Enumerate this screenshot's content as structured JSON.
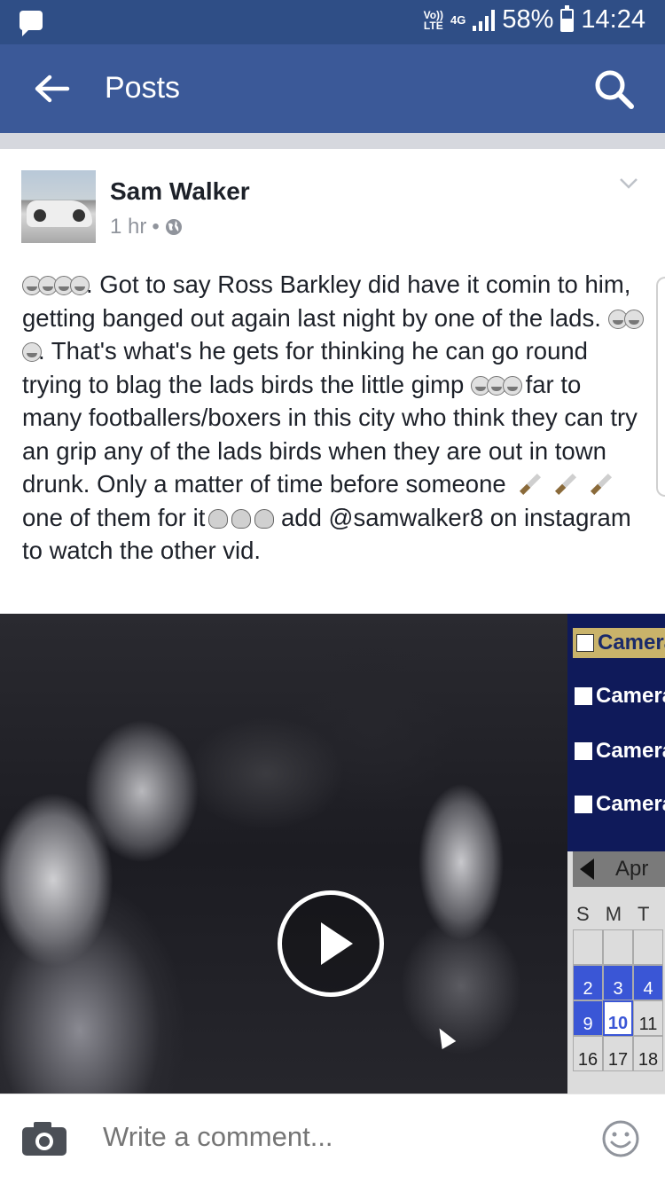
{
  "status_bar": {
    "volte": "Vo)) LTE",
    "network": "4G",
    "battery": "58%",
    "time": "14:24"
  },
  "app_bar": {
    "title": "Posts"
  },
  "post": {
    "author": "Sam Walker",
    "time": "1 hr",
    "dot": "•",
    "text": {
      "p1": ". Got to say Ross Barkley did have it comin to him, getting banged out again last night by one of the lads. ",
      "p2": ". That's what's he gets for thinking he can go round trying to blag the lads birds the little gimp ",
      "p3": " far to many footballers/boxers in this city who think they can try an grip any of the lads birds when they are out in town drunk. Only a matter of time before someone ",
      "p4": "one of them for it",
      "p5": " add @samwalker8 on instagram to watch the other vid."
    }
  },
  "video": {
    "camera_labels": [
      "Camera",
      "Camera",
      "Camera",
      "Camera"
    ],
    "calendar": {
      "month": "Apr",
      "days": [
        "S",
        "M",
        "T"
      ],
      "row1": [
        "2",
        "3",
        "4"
      ],
      "row2": [
        "9",
        "10",
        "11"
      ],
      "row3": [
        "16",
        "17",
        "18"
      ]
    }
  },
  "comment_bar": {
    "placeholder": "Write a comment..."
  },
  "colors": {
    "status_bar": "#2f4e86",
    "app_bar": "#3b5998",
    "text": "#1d2129",
    "meta": "#90949c"
  }
}
